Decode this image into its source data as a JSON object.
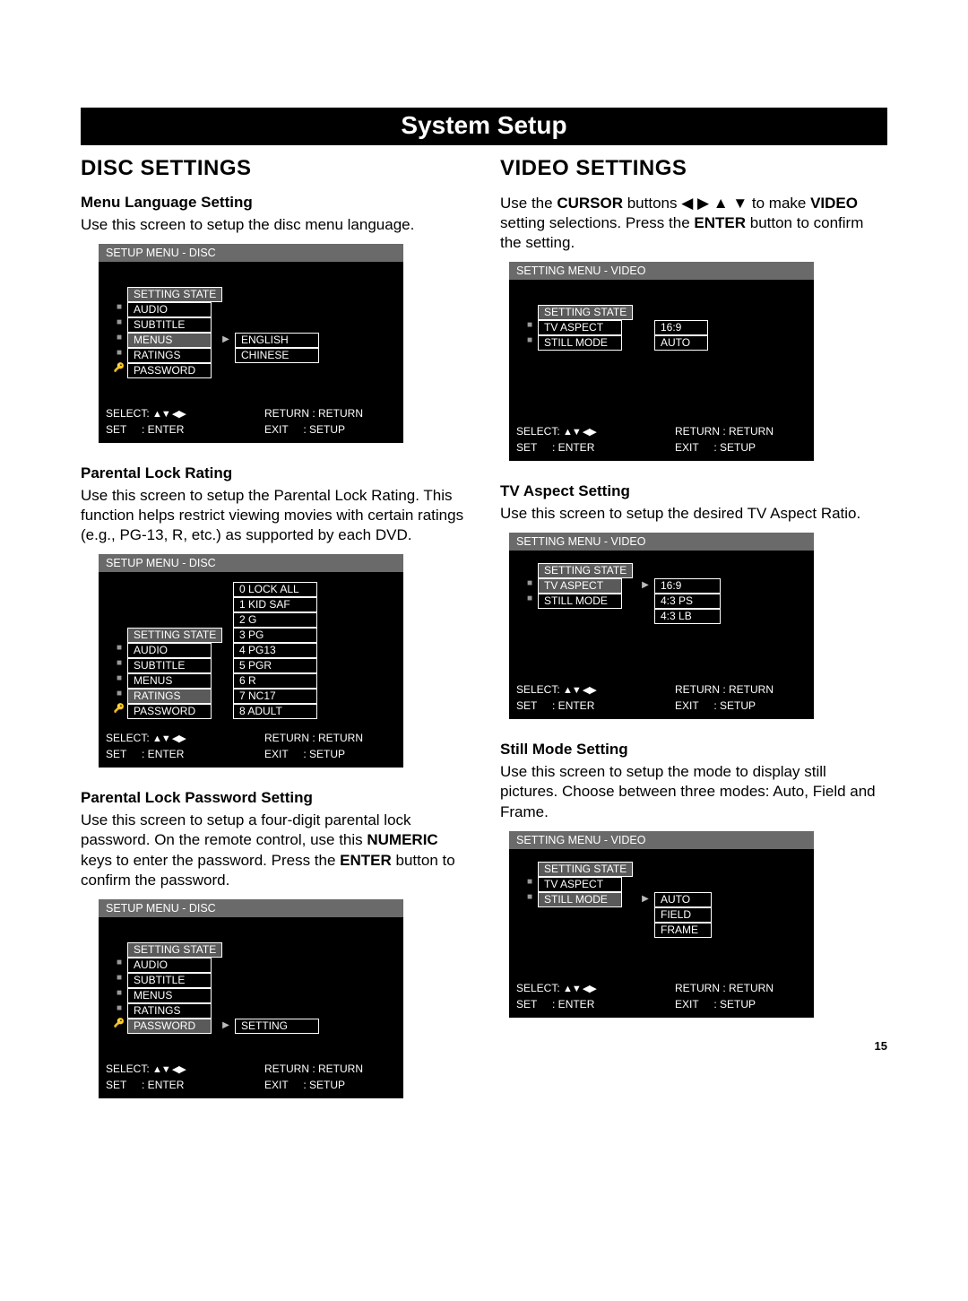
{
  "page": {
    "banner": "System Setup",
    "pageNumber": "15"
  },
  "left": {
    "heading": "DISC SETTINGS",
    "s1": {
      "title": "Menu Language Setting",
      "desc": "Use this screen to setup the disc menu language."
    },
    "s2": {
      "title": "Parental Lock Rating",
      "desc": "Use this screen to setup the Parental Lock Rating. This function helps restrict viewing movies with certain ratings (e.g., PG-13, R, etc.) as supported by each DVD."
    },
    "s3": {
      "title": "Parental Lock Password Setting",
      "desc_html": "Use this screen to setup a four-digit parental lock password. On the remote control, use this <b>NUMERIC</b> keys to enter the password. Press the <b>ENTER</b> button to confirm the password."
    }
  },
  "right": {
    "heading": "VIDEO SETTINGS",
    "intro_html": "Use the <b>CURSOR</b> buttons ◀ ▶ ▲ ▼ to make <b>VIDEO</b> setting selections. Press the <b>ENTER</b> button to confirm the setting.",
    "s1": {
      "title": "TV Aspect Setting",
      "desc": "Use this screen to setup the desired TV Aspect Ratio."
    },
    "s2": {
      "title": "Still Mode Setting",
      "desc": "Use this screen to setup the mode to display still pictures. Choose between three modes: Auto, Field and Frame."
    }
  },
  "osd_disc_title": "SETUP MENU - DISC",
  "osd_video_title": "SETTING MENU - VIDEO",
  "setting_state": "SETTING STATE",
  "disc_items": {
    "audio": "AUDIO",
    "subtitle": "SUBTITLE",
    "menus": "MENUS",
    "ratings": "RATINGS",
    "password": "PASSWORD"
  },
  "video_items": {
    "tv_aspect": "TV ASPECT",
    "still_mode": "STILL MODE"
  },
  "opts": {
    "english": "ENGLISH",
    "chinese": "CHINESE",
    "setting": "SETTING",
    "r0": "0 LOCK ALL",
    "r1": "1 KID SAF",
    "r2": "2 G",
    "r3": "3 PG",
    "r4": "4 PG13",
    "r5": "5 PGR",
    "r6": "6 R",
    "r7": "7 NC17",
    "r8": "8 ADULT",
    "a169": "16:9",
    "a43ps": "4:3    PS",
    "a43lb": "4:3    LB",
    "auto": "AUTO",
    "field": "FIELD",
    "frame": "FRAME"
  },
  "footer": {
    "select": "SELECT:",
    "return": "RETURN : RETURN",
    "set": "SET",
    "enter": ": ENTER",
    "exit": "EXIT",
    "setup": ": SETUP"
  }
}
